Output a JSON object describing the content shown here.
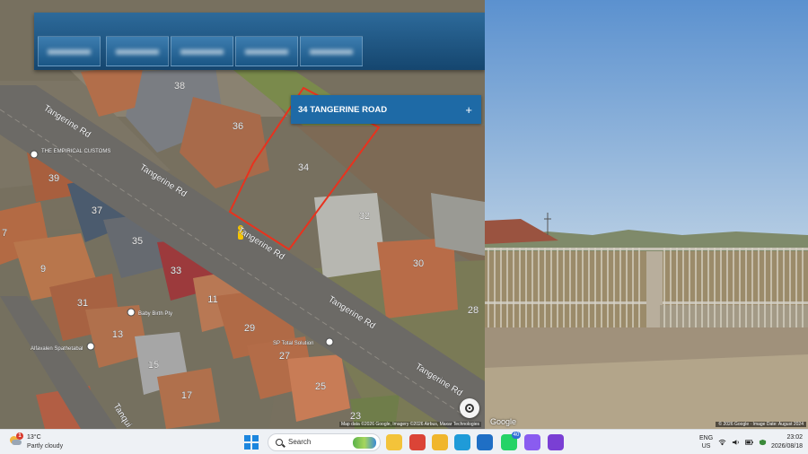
{
  "map": {
    "address_card": {
      "title": "34 TANGERINE ROAD",
      "action_icon": "plus-icon"
    },
    "streets": [
      {
        "name": "Tangerine Rd"
      },
      {
        "name": "Tangerine Rd"
      },
      {
        "name": "Tangerine Rd"
      },
      {
        "name": "Tangerine Rd"
      },
      {
        "name": "Tangerine Rd"
      },
      {
        "name": "Tanqui"
      }
    ],
    "house_numbers": [
      "38",
      "36",
      "34",
      "39",
      "37",
      "35",
      "32",
      "33",
      "30",
      "9",
      "31",
      "28",
      "11",
      "29",
      "13",
      "15",
      "27",
      "17",
      "25",
      "23",
      "7"
    ],
    "places": [
      {
        "name": "THE EMPIRICAL CUSTOMS",
        "icon": "place-pin-icon"
      },
      {
        "name": "Baby Birth Pty",
        "icon": "place-pin-icon"
      },
      {
        "name": "SP Total Solution",
        "icon": "place-pin-icon"
      },
      {
        "name": "Alfavalen Spathetabal",
        "icon": "place-pin-icon"
      }
    ],
    "attribution": "Map data ©2026 Google, Imagery ©2026 Airbus, Maxar Technologies",
    "recenter_icon": "recenter-icon",
    "pegman_icon": "pegman-icon",
    "highlight_color": "#e8321e"
  },
  "street_view": {
    "logo": "Google",
    "attribution": "© 2026 Google · Image Date: August 2024"
  },
  "taskbar": {
    "weather": {
      "temp": "13°C",
      "desc": "Partly cloudy",
      "alert": "1"
    },
    "search_label": "Search",
    "apps": [
      {
        "name": "file-explorer-icon",
        "color": "#f3c33a"
      },
      {
        "name": "chrome-icon",
        "color": "#db4437"
      },
      {
        "name": "folder-icon",
        "color": "#f0b62c"
      },
      {
        "name": "edge-icon",
        "color": "#1f9bd8"
      },
      {
        "name": "outlook-icon",
        "color": "#1f6fc5"
      },
      {
        "name": "whatsapp-icon",
        "color": "#25d366",
        "badge": "40"
      },
      {
        "name": "copilot-icon",
        "color": "#8a5cf0"
      },
      {
        "name": "clipchamp-icon",
        "color": "#7a3fd4"
      }
    ],
    "language": {
      "line1": "ENG",
      "line2": "US"
    },
    "clock": {
      "time": "23:02",
      "date": "2026/08/18"
    }
  }
}
